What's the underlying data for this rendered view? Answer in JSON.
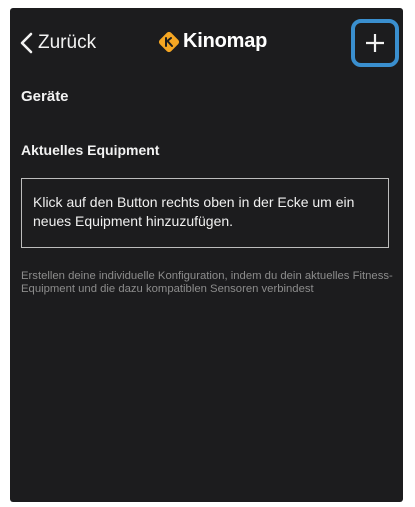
{
  "navbar": {
    "back_label": "Zurück",
    "logo_text": "Kinomap",
    "add_label": "+"
  },
  "page": {
    "section_title": "Geräte",
    "current_equipment_title": "Aktuelles Equipment",
    "empty_message": "Klick auf den Button rechts oben in der Ecke um ein neues Equipment hinzuzufügen.",
    "hint": "Erstellen deine individuelle Konfiguration, indem du dein aktuelles Fitness-Equipment und die dazu kompatiblen Sensoren verbindest"
  },
  "colors": {
    "background": "#1c1c1e",
    "highlight": "#3a8fcf",
    "logo_accent": "#f5a623"
  },
  "icons": {
    "back": "chevron-left-icon",
    "logo": "kinomap-logo-icon",
    "add": "plus-icon"
  }
}
